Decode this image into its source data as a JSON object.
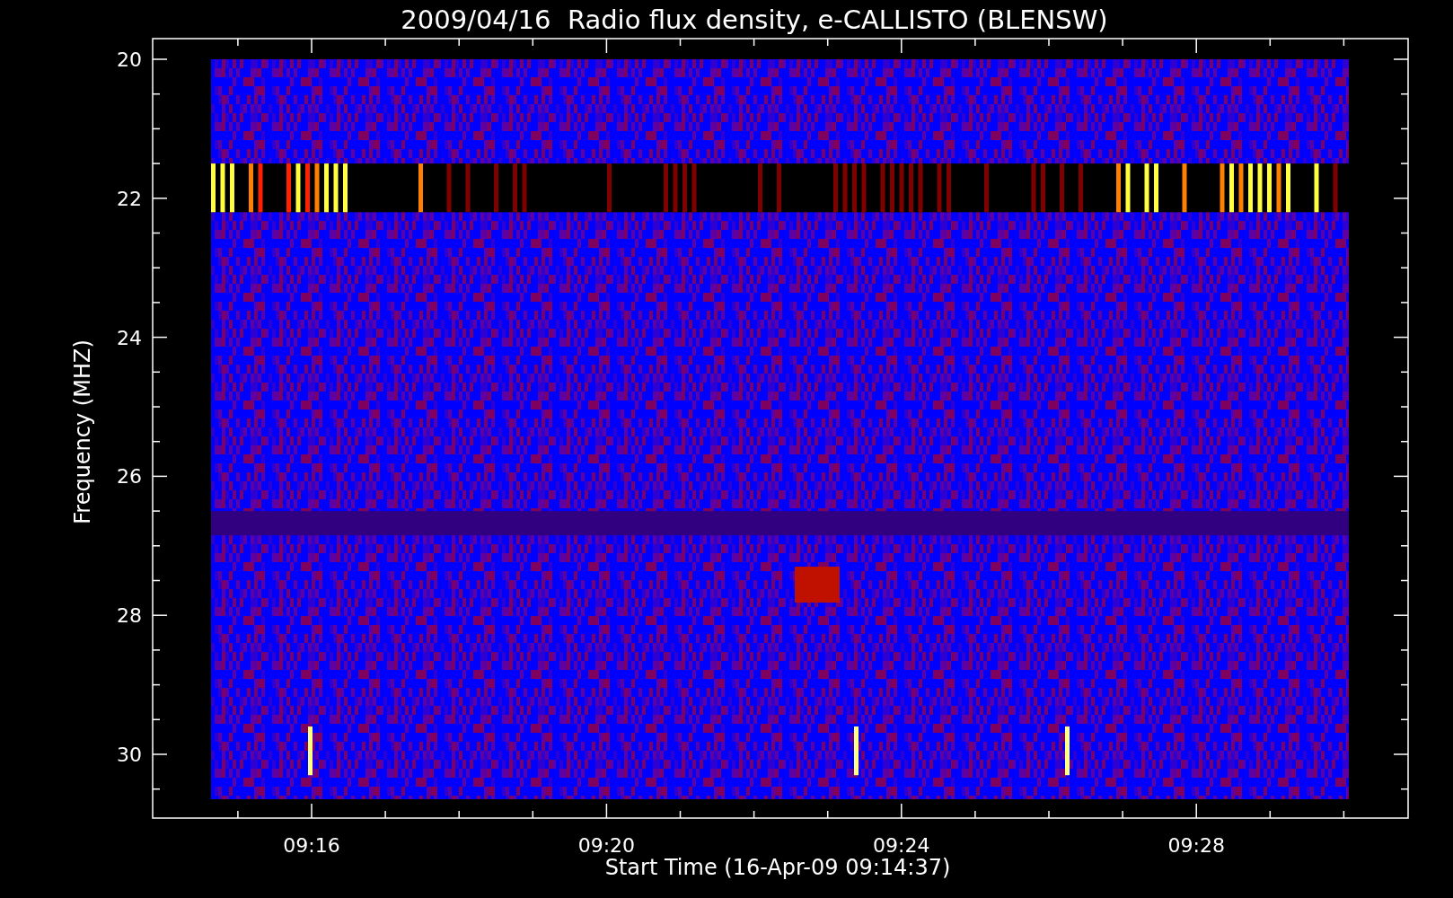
{
  "title": "2009/04/16  Radio flux density, e-CALLISTO (BLENSW)",
  "y_axis": {
    "label": "Frequency (MHZ)",
    "ticks": [
      "20",
      "22",
      "24",
      "26",
      "28",
      "30"
    ]
  },
  "x_axis": {
    "label": "Start Time (16-Apr-09 09:14:37)",
    "ticks": [
      "09:16",
      "09:20",
      "09:24",
      "09:28"
    ]
  }
}
